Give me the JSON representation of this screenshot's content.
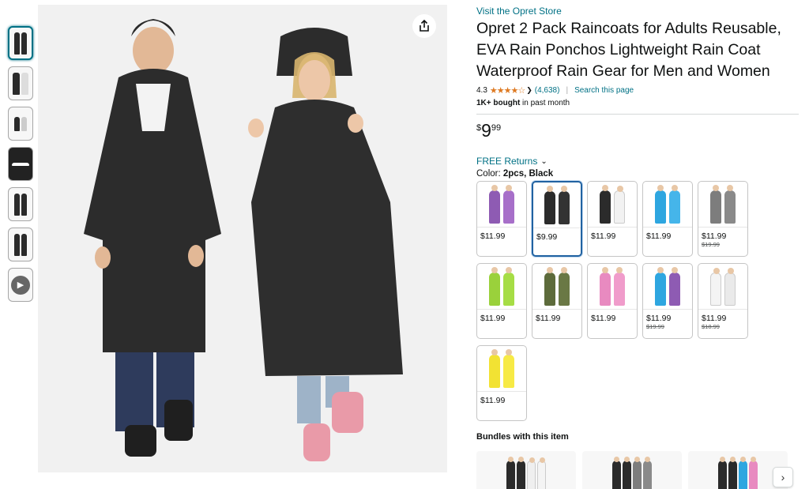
{
  "store": {
    "link_text": "Visit the Opret Store"
  },
  "product": {
    "title": "Opret 2 Pack Raincoats for Adults Reusable, EVA Rain Ponchos Lightweight Rain Coat Waterproof Rain Gear for Men and Women",
    "rating": "4.3",
    "stars": "★★★★☆",
    "review_count": "(4,638)",
    "search_page": "Search this page",
    "bought_bold": "1K+ bought",
    "bought_rest": " in past month",
    "price_symbol": "$",
    "price_whole": "9",
    "price_fraction": "99",
    "returns": "FREE Returns",
    "color_label": "Color: ",
    "color_value": "2pcs, Black"
  },
  "gallery": {
    "thumbnail_count": 7,
    "share_icon": "share-icon"
  },
  "swatches": [
    {
      "price": "$11.99",
      "list_price": "",
      "colors": [
        "#8e5bb3",
        "#a76fc9"
      ]
    },
    {
      "price": "$9.99",
      "list_price": "",
      "colors": [
        "#2b2b2b",
        "#333333"
      ],
      "selected": true
    },
    {
      "price": "$11.99",
      "list_price": "",
      "colors": [
        "#2b2b2b",
        "#f2f2f2"
      ]
    },
    {
      "price": "$11.99",
      "list_price": "",
      "colors": [
        "#2ea6e0",
        "#45b5ea"
      ]
    },
    {
      "price": "$11.99",
      "list_price": "$19.99",
      "colors": [
        "#7d7d7d",
        "#8a8a8a"
      ]
    },
    {
      "price": "$11.99",
      "list_price": "",
      "colors": [
        "#9ad13b",
        "#a6dd45"
      ]
    },
    {
      "price": "$11.99",
      "list_price": "",
      "colors": [
        "#5d6b3b",
        "#6a7845"
      ]
    },
    {
      "price": "$11.99",
      "list_price": "",
      "colors": [
        "#e88ac0",
        "#f09ccb"
      ]
    },
    {
      "price": "$11.99",
      "list_price": "$19.99",
      "colors": [
        "#2ea6e0",
        "#8e5bb3"
      ]
    },
    {
      "price": "$11.99",
      "list_price": "$18.99",
      "colors": [
        "#f4f4f4",
        "#eaeaea"
      ]
    },
    {
      "price": "$11.99",
      "list_price": "",
      "colors": [
        "#f2e233",
        "#f7ea45"
      ]
    }
  ],
  "bundles": {
    "title": "Bundles with this item",
    "items": [
      {
        "colors": [
          "#2b2b2b",
          "#2b2b2b",
          "#efefef",
          "#f4f4f4"
        ]
      },
      {
        "colors": [
          "#2b2b2b",
          "#2b2b2b",
          "#7d7d7d",
          "#8a8a8a"
        ]
      },
      {
        "colors": [
          "#2b2b2b",
          "#2b2b2b",
          "#2ea6e0",
          "#e88ac0"
        ]
      }
    ],
    "next_label": "›"
  }
}
